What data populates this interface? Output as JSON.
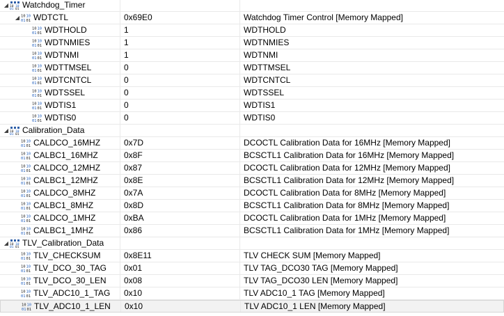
{
  "rows": [
    {
      "level": 0,
      "kind": "group",
      "expanded": true,
      "name": "Watchdog_Timer",
      "value": "",
      "desc": ""
    },
    {
      "level": 1,
      "kind": "register",
      "expanded": true,
      "name": "WDTCTL",
      "value": "0x69E0",
      "desc": "Watchdog Timer Control [Memory Mapped]"
    },
    {
      "level": 2,
      "kind": "field",
      "name": "WDTHOLD",
      "value": "1",
      "desc": "WDTHOLD"
    },
    {
      "level": 2,
      "kind": "field",
      "name": "WDTNMIES",
      "value": "1",
      "desc": "WDTNMIES"
    },
    {
      "level": 2,
      "kind": "field",
      "name": "WDTNMI",
      "value": "1",
      "desc": "WDTNMI"
    },
    {
      "level": 2,
      "kind": "field",
      "name": "WDTTMSEL",
      "value": "0",
      "desc": "WDTTMSEL"
    },
    {
      "level": 2,
      "kind": "field",
      "name": "WDTCNTCL",
      "value": "0",
      "desc": "WDTCNTCL"
    },
    {
      "level": 2,
      "kind": "field",
      "name": "WDTSSEL",
      "value": "0",
      "desc": "WDTSSEL"
    },
    {
      "level": 2,
      "kind": "field",
      "name": "WDTIS1",
      "value": "0",
      "desc": "WDTIS1"
    },
    {
      "level": 2,
      "kind": "field",
      "name": "WDTIS0",
      "value": "0",
      "desc": "WDTIS0"
    },
    {
      "level": 0,
      "kind": "group",
      "expanded": true,
      "name": "Calibration_Data",
      "value": "",
      "desc": ""
    },
    {
      "level": 1,
      "kind": "register",
      "name": "CALDCO_16MHZ",
      "value": "0x7D",
      "desc": "DCOCTL  Calibration Data for 16MHz [Memory Mapped]"
    },
    {
      "level": 1,
      "kind": "register",
      "name": "CALBC1_16MHZ",
      "value": "0x8F",
      "desc": "BCSCTL1 Calibration Data for 16MHz [Memory Mapped]"
    },
    {
      "level": 1,
      "kind": "register",
      "name": "CALDCO_12MHZ",
      "value": "0x87",
      "desc": "DCOCTL  Calibration Data for 12MHz [Memory Mapped]"
    },
    {
      "level": 1,
      "kind": "register",
      "name": "CALBC1_12MHZ",
      "value": "0x8E",
      "desc": "BCSCTL1 Calibration Data for 12MHz [Memory Mapped]"
    },
    {
      "level": 1,
      "kind": "register",
      "name": "CALDCO_8MHZ",
      "value": "0x7A",
      "desc": "DCOCTL  Calibration Data for 8MHz [Memory Mapped]"
    },
    {
      "level": 1,
      "kind": "register",
      "name": "CALBC1_8MHZ",
      "value": "0x8D",
      "desc": "BCSCTL1 Calibration Data for 8MHz [Memory Mapped]"
    },
    {
      "level": 1,
      "kind": "register",
      "name": "CALDCO_1MHZ",
      "value": "0xBA",
      "desc": "DCOCTL  Calibration Data for 1MHz [Memory Mapped]"
    },
    {
      "level": 1,
      "kind": "register",
      "name": "CALBC1_1MHZ",
      "value": "0x86",
      "desc": "BCSCTL1 Calibration Data for 1MHz [Memory Mapped]"
    },
    {
      "level": 0,
      "kind": "group",
      "expanded": true,
      "name": "TLV_Calibration_Data",
      "value": "",
      "desc": ""
    },
    {
      "level": 1,
      "kind": "register",
      "name": "TLV_CHECKSUM",
      "value": "0x8E11",
      "desc": "TLV CHECK SUM [Memory Mapped]"
    },
    {
      "level": 1,
      "kind": "register",
      "name": "TLV_DCO_30_TAG",
      "value": "0x01",
      "desc": "TLV TAG_DCO30 TAG [Memory Mapped]"
    },
    {
      "level": 1,
      "kind": "register",
      "name": "TLV_DCO_30_LEN",
      "value": "0x08",
      "desc": "TLV TAG_DCO30 LEN [Memory Mapped]"
    },
    {
      "level": 1,
      "kind": "register",
      "name": "TLV_ADC10_1_TAG",
      "value": "0x10",
      "desc": "TLV ADC10_1 TAG [Memory Mapped]"
    },
    {
      "level": 1,
      "kind": "register",
      "name": "TLV_ADC10_1_LEN",
      "value": "0x10",
      "desc": "TLV ADC10_1 LEN [Memory Mapped]",
      "selected": true
    }
  ],
  "colors": {
    "group_icon_blue": "#2f5fa8",
    "bits_icon_blue": "#1f5fbf",
    "bits_icon_dark": "#222222",
    "grid": "#e9e9e9",
    "selected_row": "#f2f2f2"
  },
  "icons": {
    "group": "register-group-icon",
    "bits": "binary-register-icon"
  }
}
